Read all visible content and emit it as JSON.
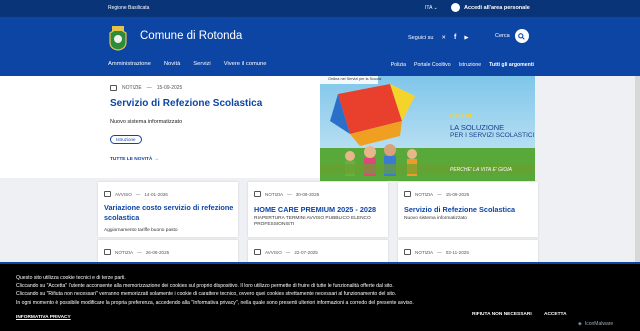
{
  "topbar": {
    "region": "Regione Basilicata",
    "lang": "ITA",
    "login": "Accedi all'area personale"
  },
  "header": {
    "name": "Comune di Rotonda",
    "social_label": "Seguici su",
    "search_label": "Cerca"
  },
  "nav": {
    "main": [
      "Amministrazione",
      "Novità",
      "Servizi",
      "Vivere il comune"
    ],
    "secondary": [
      "Polizia",
      "Portale Cooltivo",
      "Istruzione"
    ],
    "all": "Tutti gli argomenti"
  },
  "hero": {
    "kind": "NOTIZIE",
    "date": "15-09-2025",
    "title": "Servizio di Refezione Scolastica",
    "desc": "Nuovo sistema informatizzato",
    "tag": "Istruzione",
    "more": "TUTTE LE NOVITÀ"
  },
  "hero_image": {
    "banner": "Ordina nel Servizi per la Scuola",
    "head": "CIBAMI",
    "line1": "LA SOLUZIONE",
    "line2": "PER I SERVIZI SCOLASTICI",
    "footer": "PERCHE' LA VITA E' GIOIA"
  },
  "cards": [
    {
      "kind": "AVVISO",
      "date": "14-01-2026",
      "title": "Variazione costo servizio di refezione scolastica",
      "desc": "Aggiornamento tariffe buono pasto"
    },
    {
      "kind": "NOTIZIA",
      "date": "30-09-2025",
      "title": "HOME CARE PREMIUM 2025 - 2028",
      "desc": "RIAPERTURA TERMINI AVVISO PUBBLICO ELENCO PROFESSIONISTI"
    },
    {
      "kind": "NOTIZIA",
      "date": "15-09-2025",
      "title": "Servizio di Refezione Scolastica",
      "desc": "Nuovo sistema informatizzato"
    },
    {
      "kind": "NOTIZIA",
      "date": "26-08-2025",
      "title": "",
      "desc": ""
    },
    {
      "kind": "AVVISO",
      "date": "22-07-2025",
      "title": "",
      "desc": ""
    },
    {
      "kind": "NOTIZIA",
      "date": "03-11-2025",
      "title": "",
      "desc": ""
    }
  ],
  "cookie": {
    "lines": [
      "Questo sito utilizza cookie tecnici e di terze parti.",
      "Cliccando su \"Accetta\" l'utente acconsente alla memorizzazione dei cookies sul proprio dispositivo. Il loro utilizzo permette di fruire di tutte le funzionalità offerte dal sito.",
      "Cliccando su \"Rifiuta non necessari\" verranno memorizzati solamente i cookie di carattere tecnico, ovvero quei cookies strettamente necessari al funzionamento del sito.",
      "In ogni momento è possibile modificare la propria preferenza, accedendo alla \"Informativa privacy\", nella quale sono presenti ulteriori informazioni a corredo del presente avviso."
    ],
    "policy": "INFORMATIVA PRIVACY",
    "reject": "RIFIUTA NON NECESSARI",
    "accept": "ACCETTA",
    "brand": "IconMalware"
  },
  "colors": {
    "primary": "#0d45a5",
    "topbar": "#0a3478"
  }
}
